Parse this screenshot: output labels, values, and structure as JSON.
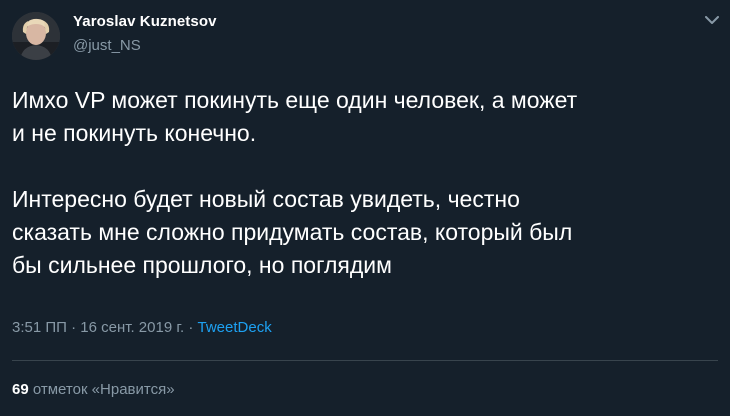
{
  "author": {
    "display_name": "Yaroslav Kuznetsov",
    "handle": "@just_NS",
    "avatar_icon": "profile-photo"
  },
  "tweet": {
    "text": "Имхо VP может покинуть еще один человек, а может\nи не покинуть конечно.\n\nИнтересно будет новый состав увидеть, честно\nсказать мне сложно придумать состав, который был\nбы сильнее прошлого, но поглядим",
    "time": "3:51 ПП",
    "date": "16 сент. 2019 г.",
    "separator": "·",
    "source": "TweetDeck"
  },
  "stats": {
    "likes_count": "69",
    "likes_label": "отметок «Нравится»"
  },
  "colors": {
    "background": "#15202b",
    "primary_text": "#ffffff",
    "secondary_text": "#8899a6",
    "accent": "#1da1f2",
    "divider": "#38444d"
  },
  "icons": {
    "menu": "chevron-down-icon"
  }
}
